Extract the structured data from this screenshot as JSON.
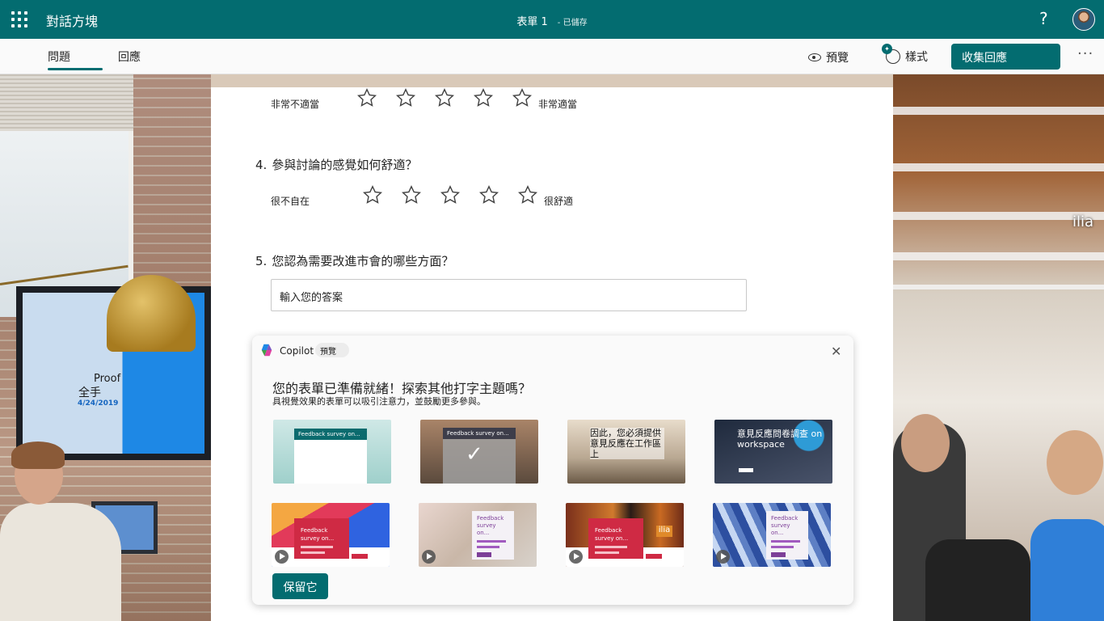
{
  "appbar": {
    "app_name": "對話方塊",
    "doc_title": "表單 1",
    "save_status": "- 已儲存",
    "help": "?"
  },
  "toolbar": {
    "tab_questions": "問題",
    "tab_responses": "回應",
    "preview_label": "預覽",
    "style_label": "樣式",
    "collect_label": "收集回應",
    "more": "···"
  },
  "background": {
    "left_tv_title": "Proof",
    "left_tv_zh": "全手",
    "left_tv_date": "4/24/2019",
    "right_sign": "ilia"
  },
  "form": {
    "q3": {
      "low_label": "非常不適當",
      "high_label": "非常適當",
      "stars": 5
    },
    "q4": {
      "number": "4.",
      "title": "參與討論的感覺如何舒適？",
      "low_label": "很不自在",
      "high_label": "很舒適",
      "stars": 5
    },
    "q5": {
      "number": "5.",
      "title": "您認為需要改進市會的哪些方面？",
      "placeholder": "輸入您的答案"
    }
  },
  "copilot": {
    "name": "Copilot",
    "badge": "預覽",
    "close": "✕",
    "title": "您的表單已準備就緒！探索其他打字主題嗎？",
    "subtitle": "具視覺效果的表單可以吸引注意力，並鼓勵更多參與。",
    "themes": [
      {
        "text": "Feedback survey on..."
      },
      {
        "text": "Feedback survey on..."
      },
      {
        "text": "因此，您必須提供意見反應在工作區上"
      },
      {
        "text": "意見反應問卷調查 on workspace"
      },
      {
        "text": "Feedback survey on..."
      },
      {
        "text": "Feedback survey on..."
      },
      {
        "text": "Feedback survey on..."
      },
      {
        "text": "Feedback survey on..."
      }
    ],
    "theme7_sign": "ilia",
    "keep_label": "保留它"
  },
  "colors": {
    "brand": "#036c70",
    "star_outline": "#424242"
  }
}
